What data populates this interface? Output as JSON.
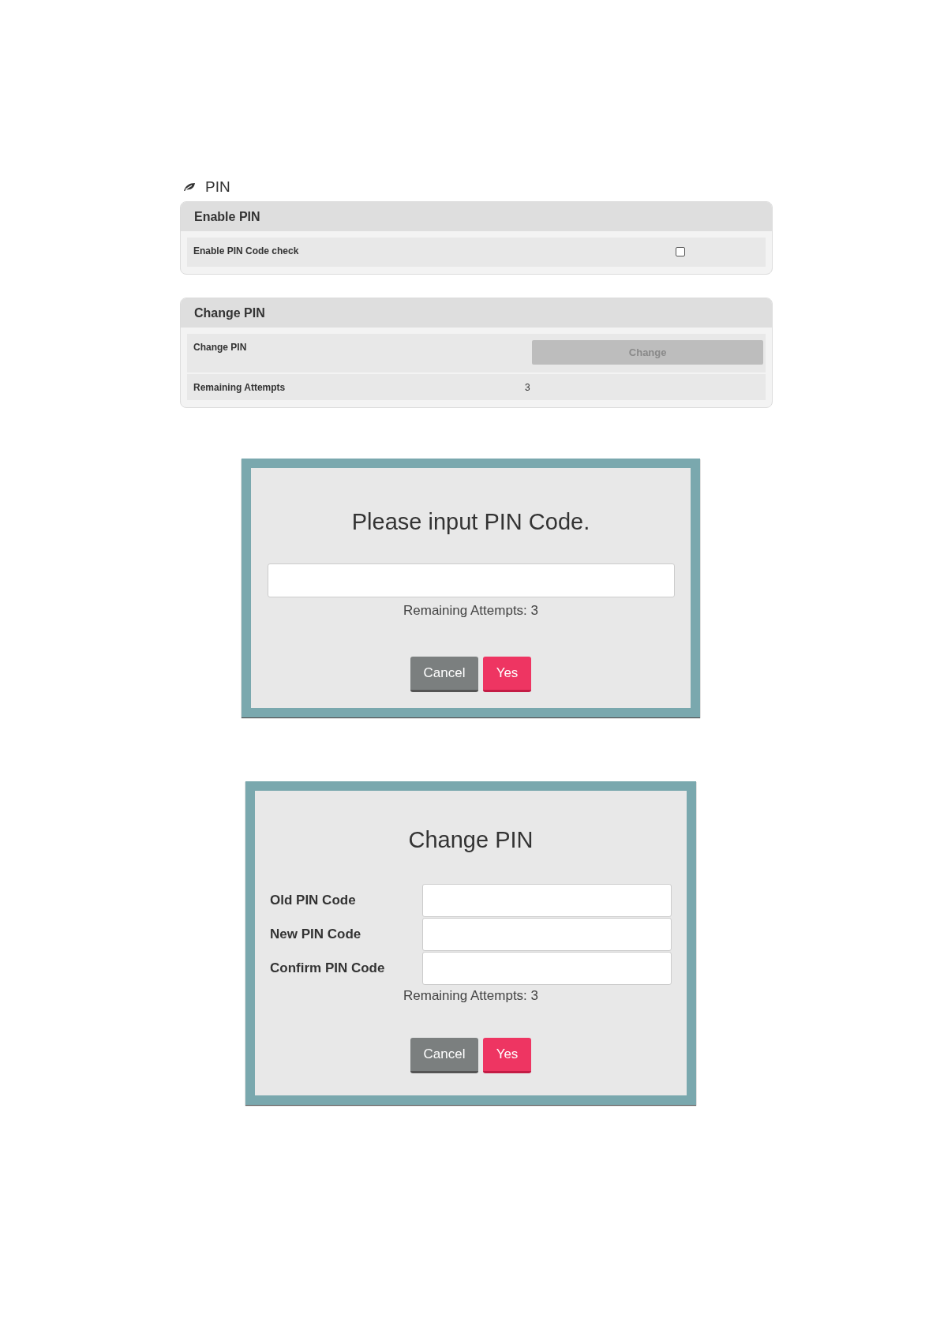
{
  "section_title": "PIN",
  "panels": [
    {
      "title": "Enable PIN",
      "rows": [
        {
          "kind": "checkbox",
          "label": "Enable PIN Code check",
          "checked": false
        }
      ]
    },
    {
      "title": "Change PIN",
      "rows": [
        {
          "kind": "button",
          "label": "Change PIN",
          "button": "Change",
          "disabled": true
        },
        {
          "kind": "value",
          "label": "Remaining Attempts",
          "value": "3"
        }
      ]
    }
  ],
  "pin_dialog": {
    "title": "Please input PIN Code.",
    "remaining": "Remaining Attempts: 3",
    "buttons": [
      "Cancel",
      "Yes"
    ]
  },
  "change_dialog": {
    "title": "Change PIN",
    "fields": [
      {
        "label": "Old PIN Code"
      },
      {
        "label": "New PIN Code"
      },
      {
        "label": "Confirm PIN Code"
      }
    ],
    "remaining": "Remaining Attempts: 3",
    "buttons": [
      "Cancel",
      "Yes"
    ]
  }
}
